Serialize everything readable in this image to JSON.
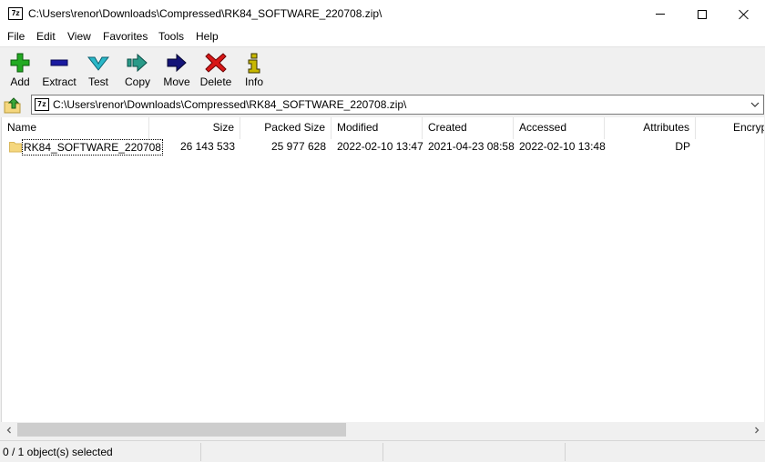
{
  "window": {
    "icon_text": "7z",
    "title": "C:\\Users\\renor\\Downloads\\Compressed\\RK84_SOFTWARE_220708.zip\\"
  },
  "menu": [
    "File",
    "Edit",
    "View",
    "Favorites",
    "Tools",
    "Help"
  ],
  "toolbar": {
    "add": "Add",
    "extract": "Extract",
    "test": "Test",
    "copy": "Copy",
    "move": "Move",
    "delete": "Delete",
    "info": "Info"
  },
  "icons": {
    "add": "plus-icon",
    "extract": "minus-icon",
    "test": "check-icon",
    "copy": "copy-arrow-icon",
    "move": "move-arrow-icon",
    "delete": "delete-x-icon",
    "info": "info-icon",
    "up": "folder-up-icon",
    "folder": "folder-icon"
  },
  "colors": {
    "add": "#22aa22",
    "extract": "#1a1aa0",
    "test": "#2ab8c8",
    "copy": "#2a9a88",
    "move": "#141478",
    "delete": "#d81818",
    "info": "#c8b800",
    "folder": "#f5d77e"
  },
  "address": {
    "icon_text": "7z",
    "path": "C:\\Users\\renor\\Downloads\\Compressed\\RK84_SOFTWARE_220708.zip\\"
  },
  "columns": {
    "name": "Name",
    "size": "Size",
    "packed_size": "Packed Size",
    "modified": "Modified",
    "created": "Created",
    "accessed": "Accessed",
    "attributes": "Attributes",
    "encrypted": "Encryp"
  },
  "rows": [
    {
      "name": "RK84_SOFTWARE_220708",
      "size": "26 143 533",
      "packed_size": "25 977 628",
      "modified": "2022-02-10 13:47",
      "created": "2021-04-23 08:58",
      "accessed": "2022-02-10 13:48",
      "attributes": "DP"
    }
  ],
  "status": {
    "selection": "0 / 1 object(s) selected"
  }
}
